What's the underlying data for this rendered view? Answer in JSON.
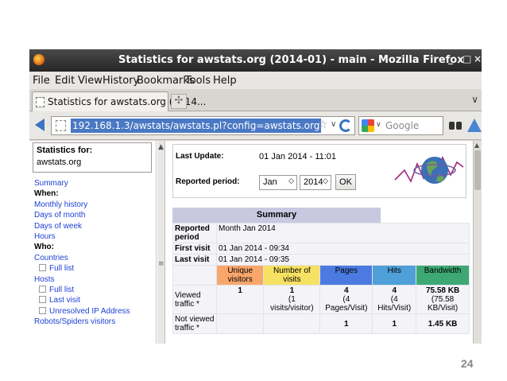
{
  "window": {
    "title": "Statistics for awstats.org (2014-01) - main - Mozilla Firefox",
    "controls": [
      "_",
      "□",
      "×"
    ]
  },
  "menubar": {
    "items": [
      {
        "label": "File"
      },
      {
        "label": "Edit"
      },
      {
        "label": "View"
      },
      {
        "label": "History"
      },
      {
        "label": "Bookmarks"
      },
      {
        "label": "Tools"
      },
      {
        "label": "Help"
      }
    ]
  },
  "tabs": {
    "active_label": "Statistics for awstats.org (2014...",
    "new_tab_symbol": "✣",
    "overflow_symbol": "∨"
  },
  "navbar": {
    "url": "192.168.1.3/awstats/awstats.pl?config=awstats.org",
    "search_placeholder": "Google",
    "star": "☆",
    "url_dropdown": "∨",
    "search_dropdown": "∨"
  },
  "sidebar": {
    "stats_for_label": "Statistics for:",
    "stats_for_value": "awstats.org",
    "items": [
      {
        "label": "Summary",
        "kind": "link"
      },
      {
        "label": "When:",
        "kind": "header"
      },
      {
        "label": "Monthly history",
        "kind": "link"
      },
      {
        "label": "Days of month",
        "kind": "link"
      },
      {
        "label": "Days of week",
        "kind": "link"
      },
      {
        "label": "Hours",
        "kind": "link"
      },
      {
        "label": "Who:",
        "kind": "header"
      },
      {
        "label": "Countries",
        "kind": "link"
      },
      {
        "label": "Full list",
        "kind": "sub"
      },
      {
        "label": "Hosts",
        "kind": "link"
      },
      {
        "label": "Full list",
        "kind": "sub"
      },
      {
        "label": "Last visit",
        "kind": "sub"
      },
      {
        "label": "Unresolved IP Address",
        "kind": "sub"
      },
      {
        "label": "Robots/Spiders visitors",
        "kind": "link"
      }
    ]
  },
  "info": {
    "last_update_label": "Last Update:",
    "last_update_value": "01 Jan 2014 - 11:01",
    "reported_period_label": "Reported period:",
    "month_select": "Jan",
    "year_select": "2014",
    "ok_label": "OK"
  },
  "summary": {
    "title": "Summary",
    "reported_period_label": "Reported period",
    "reported_period_value": "Month Jan 2014",
    "first_visit_label": "First visit",
    "first_visit_value": "01 Jan 2014 - 09:34",
    "last_visit_label": "Last visit",
    "last_visit_value": "01 Jan 2014 - 09:35",
    "headers": {
      "unique_visitors": "Unique visitors",
      "number_of_visits": "Number of visits",
      "pages": "Pages",
      "hits": "Hits",
      "bandwidth": "Bandwidth"
    },
    "viewed": {
      "label": "Viewed traffic *",
      "unique_visitors": "1",
      "number_of_visits": "1",
      "number_of_visits_sub": "(1 visits/visitor)",
      "pages": "4",
      "pages_sub": "(4 Pages/Visit)",
      "hits": "4",
      "hits_sub": "(4 Hits/Visit)",
      "bandwidth": "75.58 KB",
      "bandwidth_sub": "(75.58 KB/Visit)"
    },
    "not_viewed": {
      "label": "Not viewed traffic *",
      "pages": "1",
      "hits": "1",
      "bandwidth": "1.45 KB"
    }
  },
  "slide": {
    "page_number": "24"
  }
}
